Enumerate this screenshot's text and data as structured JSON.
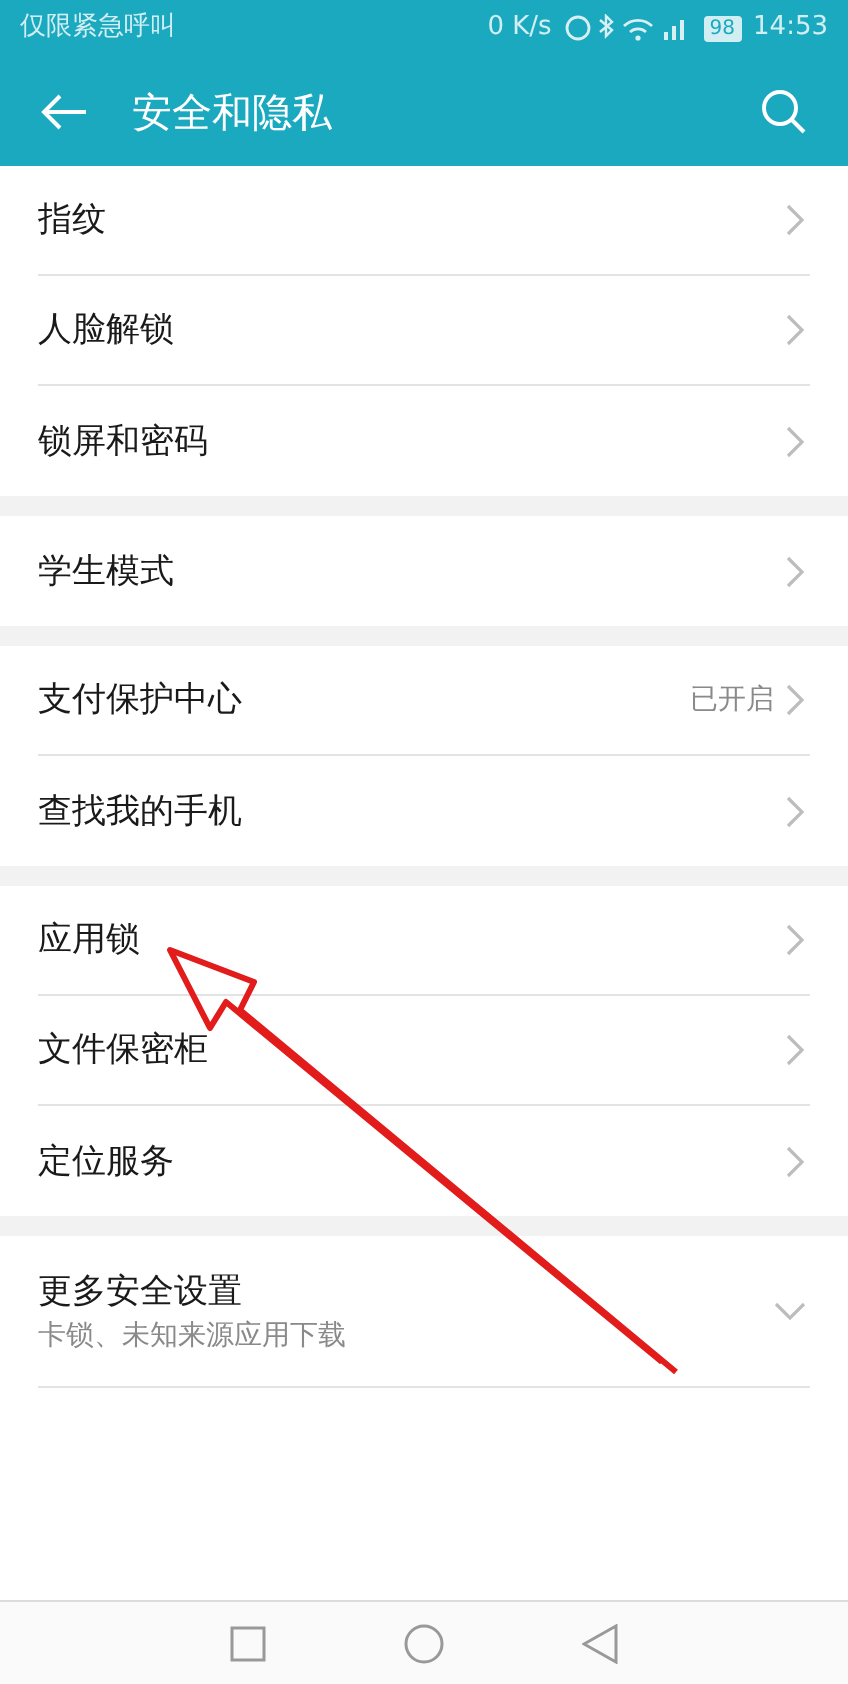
{
  "status_bar": {
    "carrier": "仅限紧急呼叫",
    "speed": "0 K/s",
    "battery": "98",
    "time": "14:53"
  },
  "app_bar": {
    "title": "安全和隐私"
  },
  "groups": [
    {
      "items": [
        {
          "kind": "link",
          "label": "指纹"
        },
        {
          "kind": "link",
          "label": "人脸解锁"
        },
        {
          "kind": "link",
          "label": "锁屏和密码"
        }
      ]
    },
    {
      "items": [
        {
          "kind": "link",
          "label": "学生模式"
        }
      ]
    },
    {
      "items": [
        {
          "kind": "link",
          "label": "支付保护中心",
          "value": "已开启"
        },
        {
          "kind": "link",
          "label": "查找我的手机"
        }
      ]
    },
    {
      "items": [
        {
          "kind": "link",
          "label": "应用锁"
        },
        {
          "kind": "link",
          "label": "文件保密柜"
        },
        {
          "kind": "link",
          "label": "定位服务"
        }
      ]
    },
    {
      "items": [
        {
          "kind": "expandable",
          "label": "更多安全设置",
          "subtitle": "卡锁、未知来源应用下载",
          "expanded": false
        }
      ]
    }
  ]
}
